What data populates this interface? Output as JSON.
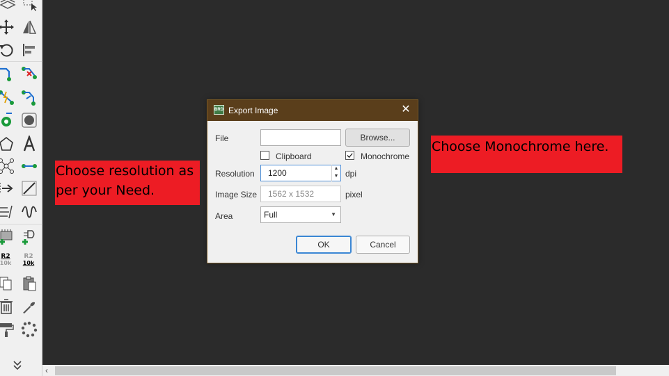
{
  "toolbar": {
    "tools": [
      "layers",
      "select",
      "move",
      "mirror",
      "rotate",
      "align",
      "wire",
      "delete-wire",
      "net-wire",
      "net-split",
      "via",
      "hole",
      "polygon",
      "text",
      "junction",
      "connection",
      "arrow",
      "line",
      "bus",
      "sine",
      "add-part",
      "add-symbol",
      "name",
      "value",
      "copy",
      "paste",
      "delete",
      "wrench",
      "paint",
      "group",
      "expand"
    ],
    "name_label_top": "R2",
    "name_label_bottom": "10k",
    "value_label_top": "R2",
    "value_label_bottom": "10k"
  },
  "annotations": {
    "left_note_line1": "Choose resolution as",
    "left_note_line2": "per your Need.",
    "right_note": "Choose Monochrome here."
  },
  "dialog": {
    "app_icon_text": "BRD",
    "title": "Export Image",
    "close_glyph": "✕",
    "file_label": "File",
    "file_value": "",
    "browse_label": "Browse...",
    "clipboard_label": "Clipboard",
    "clipboard_checked": false,
    "monochrome_label": "Monochrome",
    "monochrome_checked": true,
    "resolution_label": "Resolution",
    "resolution_value": "1200",
    "resolution_unit": "dpi",
    "image_size_label": "Image Size",
    "image_size_value": "1562 x 1532",
    "image_size_unit": "pixel",
    "area_label": "Area",
    "area_value": "Full",
    "ok_label": "OK",
    "cancel_label": "Cancel"
  },
  "colors": {
    "titlebar": "#5a3e1b",
    "annotation": "#ed1c24",
    "canvas": "#2b2b2b",
    "ok_border": "#3a86d4"
  }
}
